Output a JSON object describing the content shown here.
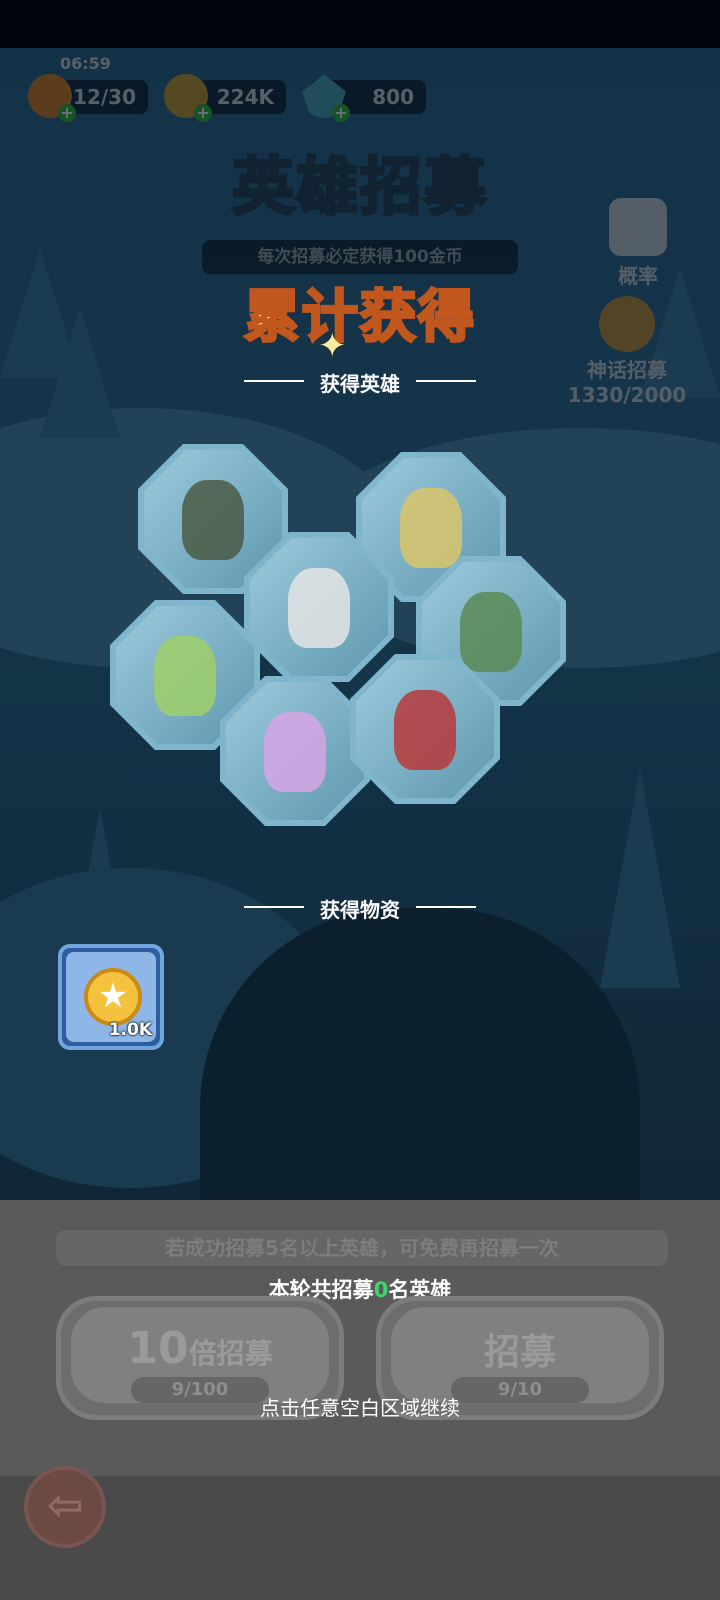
{
  "status": {
    "time": "06:59"
  },
  "resources": {
    "stamina": {
      "value": "12/30",
      "icon": "flame-icon"
    },
    "gold": {
      "value": "224K",
      "icon": "gold-coin-icon"
    },
    "gems": {
      "value": "800",
      "icon": "crystal-icon"
    }
  },
  "header": {
    "title": "英雄招募",
    "subtitle": "每次招募必定获得100金币"
  },
  "side": {
    "probability_label": "概率",
    "mythic_label": "神话招募",
    "mythic_progress": "1330/2000"
  },
  "result": {
    "heading": "累计获得",
    "heroes_section": "获得英雄",
    "items_section": "获得物资",
    "heroes": [
      {
        "name": "dark-dragon",
        "color": "#4a5a44"
      },
      {
        "name": "golden-griffin",
        "color": "#d9c46a"
      },
      {
        "name": "white-knight",
        "color": "#e4e4e4"
      },
      {
        "name": "green-beast",
        "color": "#5a8a54"
      },
      {
        "name": "forest-mage",
        "color": "#9fcf6a"
      },
      {
        "name": "fairy",
        "color": "#d6a6e6"
      },
      {
        "name": "red-demon",
        "color": "#b63a3a"
      }
    ],
    "items": [
      {
        "name": "gold-coin",
        "quantity": "1.0K"
      }
    ]
  },
  "footer": {
    "bonus_notice": "若成功招募5名以上英雄，可免费再招募一次",
    "count_prefix": "本轮共招募",
    "count_value": "0",
    "count_suffix": "名英雄",
    "recruit10_multiplier": "10",
    "recruit10_label": "倍招募",
    "recruit10_cost": "9/100",
    "recruit1_label": "招募",
    "recruit1_cost": "9/10",
    "continue_hint": "点击任意空白区域继续"
  },
  "colors": {
    "heading_fill": "#ffe9a8",
    "heading_stroke": "#c2571e",
    "count_highlight": "#3ed66a",
    "loot_frame": "#6fa7de"
  }
}
